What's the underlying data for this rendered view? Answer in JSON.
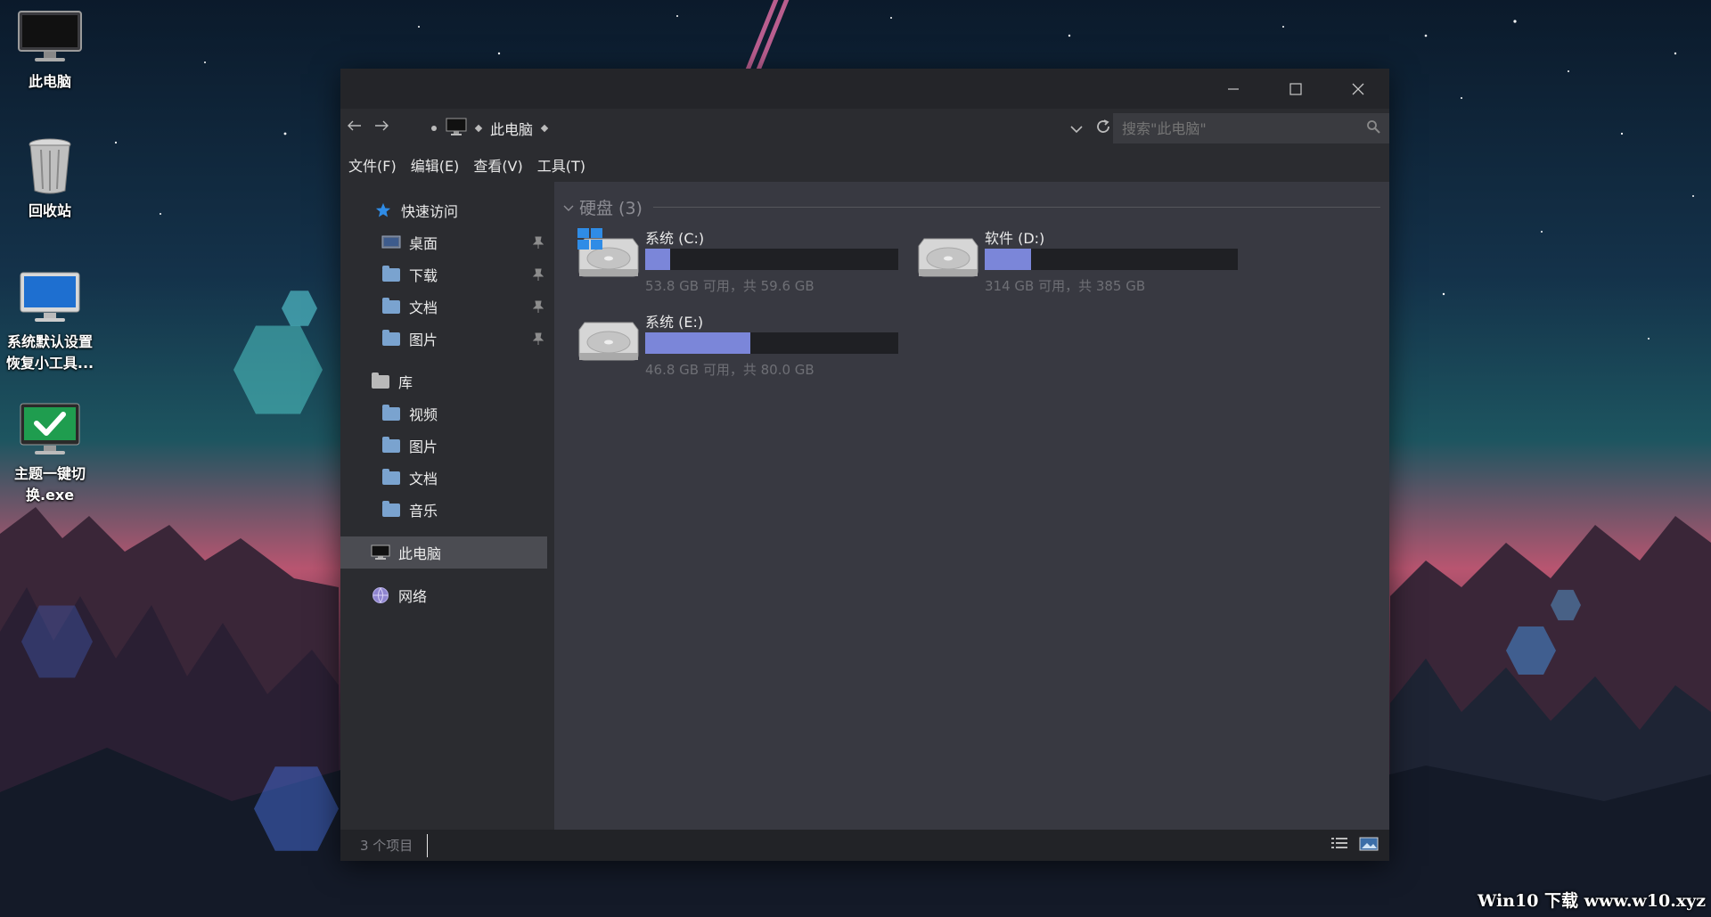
{
  "desktop": {
    "icons": [
      {
        "label_1": "此电脑",
        "label_2": "",
        "icon": "monitor-icon"
      },
      {
        "label_1": "回收站",
        "label_2": "",
        "icon": "recycle-bin-icon"
      },
      {
        "label_1": "系统默认设置",
        "label_2": "恢复小工具...",
        "icon": "monitor-blue-icon"
      },
      {
        "label_1": "主题一键切",
        "label_2": "换.exe",
        "icon": "monitor-check-icon"
      }
    ],
    "watermark": "Win10 下载 www.w10.xyz"
  },
  "window": {
    "breadcrumb": {
      "icon": "computer-icon",
      "location": "此电脑"
    },
    "search": {
      "placeholder": "搜索\"此电脑\""
    },
    "menu": [
      "文件(F)",
      "编辑(E)",
      "查看(V)",
      "工具(T)"
    ],
    "nav": {
      "quick_access": {
        "label": "快速访问",
        "icon": "star-icon",
        "items": [
          {
            "label": "桌面",
            "icon": "desktop-folder-icon",
            "pinned": true
          },
          {
            "label": "下载",
            "icon": "download-folder-icon",
            "pinned": true
          },
          {
            "label": "文档",
            "icon": "documents-folder-icon",
            "pinned": true
          },
          {
            "label": "图片",
            "icon": "pictures-folder-icon",
            "pinned": true
          }
        ]
      },
      "libraries": {
        "label": "库",
        "icon": "library-icon",
        "items": [
          {
            "label": "视频",
            "icon": "videos-folder-icon"
          },
          {
            "label": "图片",
            "icon": "pictures-folder-icon"
          },
          {
            "label": "文档",
            "icon": "documents-folder-icon"
          },
          {
            "label": "音乐",
            "icon": "music-folder-icon"
          }
        ]
      },
      "this_pc": {
        "label": "此电脑",
        "icon": "computer-icon",
        "selected": true
      },
      "network": {
        "label": "网络",
        "icon": "network-icon"
      }
    },
    "content": {
      "group_title": "硬盘 (3)",
      "drives": [
        {
          "name": "系统 (C:)",
          "info": "53.8 GB 可用，共 59.6 GB",
          "used_fraction": 0.097,
          "icon": "windows-drive-icon"
        },
        {
          "name": "软件 (D:)",
          "info": "314 GB 可用，共 385 GB",
          "used_fraction": 0.184,
          "icon": "hard-drive-icon"
        },
        {
          "name": "系统 (E:)",
          "info": "46.8 GB 可用，共 80.0 GB",
          "used_fraction": 0.415,
          "icon": "hard-drive-icon"
        }
      ]
    },
    "status": {
      "item_count": "3 个项目"
    },
    "colors": {
      "accent": "#7b86d9",
      "window_bg": "#2b2c30",
      "content_bg": "#383941"
    }
  }
}
